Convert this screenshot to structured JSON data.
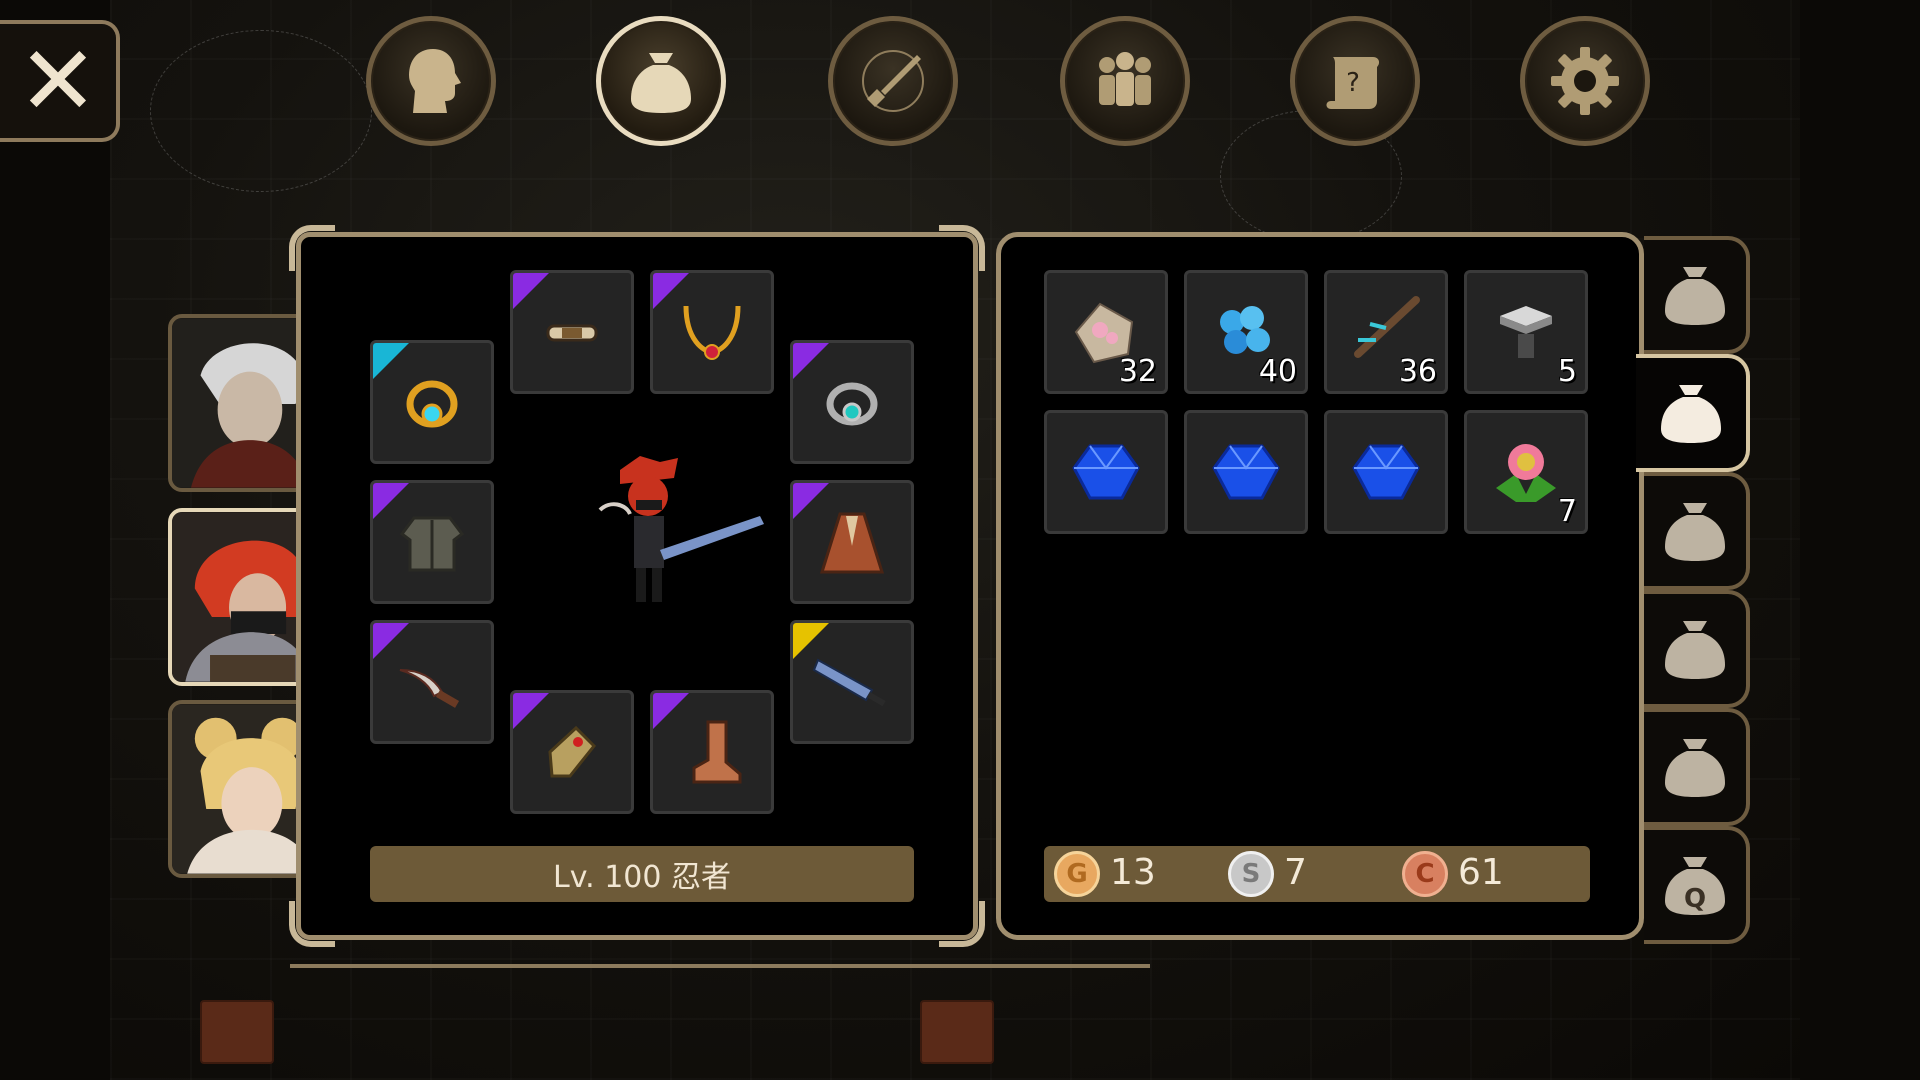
{
  "top_menu": [
    {
      "name": "character",
      "icon": "head-icon",
      "active": false
    },
    {
      "name": "inventory",
      "icon": "bag-icon",
      "active": true
    },
    {
      "name": "skills",
      "icon": "sword-compass-icon",
      "active": false
    },
    {
      "name": "party",
      "icon": "party-icon",
      "active": false
    },
    {
      "name": "quests",
      "icon": "scroll-icon",
      "active": false
    },
    {
      "name": "settings",
      "icon": "gear-icon",
      "active": false
    }
  ],
  "close_button": {
    "label": "✕"
  },
  "characters": [
    {
      "name": "white-hair-warrior",
      "active": false
    },
    {
      "name": "red-hair-ninja",
      "active": true
    },
    {
      "name": "blonde-girl",
      "active": false
    }
  ],
  "equipment": {
    "level_label": "Lv. 100 忍者",
    "slots": [
      {
        "slot": "headband",
        "rarity": "purple"
      },
      {
        "slot": "necklace",
        "rarity": "purple"
      },
      {
        "slot": "ring-left",
        "rarity": "cyan"
      },
      {
        "slot": "ring-right",
        "rarity": "purple"
      },
      {
        "slot": "armor",
        "rarity": "purple"
      },
      {
        "slot": "cloak",
        "rarity": "purple"
      },
      {
        "slot": "dagger",
        "rarity": "purple"
      },
      {
        "slot": "greatsword",
        "rarity": "yellow"
      },
      {
        "slot": "gloves",
        "rarity": "purple"
      },
      {
        "slot": "boots",
        "rarity": "purple"
      }
    ]
  },
  "inventory": {
    "items": [
      {
        "icon": "pink-ore-icon",
        "qty": "32"
      },
      {
        "icon": "blue-crystal-cluster-icon",
        "qty": "40"
      },
      {
        "icon": "magic-branch-icon",
        "qty": "36"
      },
      {
        "icon": "anvil-icon",
        "qty": "5"
      },
      {
        "icon": "sapphire-icon",
        "qty": ""
      },
      {
        "icon": "sapphire-icon",
        "qty": ""
      },
      {
        "icon": "sapphire-icon",
        "qty": ""
      },
      {
        "icon": "rafflesia-flower-icon",
        "qty": "7"
      }
    ],
    "currency": {
      "gold": "13",
      "silver": "7",
      "copper": "61",
      "gold_letter": "G",
      "silver_letter": "S",
      "copper_letter": "C"
    }
  },
  "bag_tabs": [
    {
      "icon": "bag-icon",
      "active": false
    },
    {
      "icon": "bag-icon",
      "active": true
    },
    {
      "icon": "bag-icon",
      "active": false
    },
    {
      "icon": "bag-icon",
      "active": false
    },
    {
      "icon": "bag-icon",
      "active": false
    },
    {
      "icon": "quest-bag-icon",
      "active": false,
      "letter": "Q"
    }
  ],
  "colors": {
    "rarity_purple": "#8a2be2",
    "rarity_cyan": "#19b6d6",
    "rarity_yellow": "#e6c200",
    "panel_border": "#a08e6e",
    "bar_fill": "#6d5a38"
  }
}
